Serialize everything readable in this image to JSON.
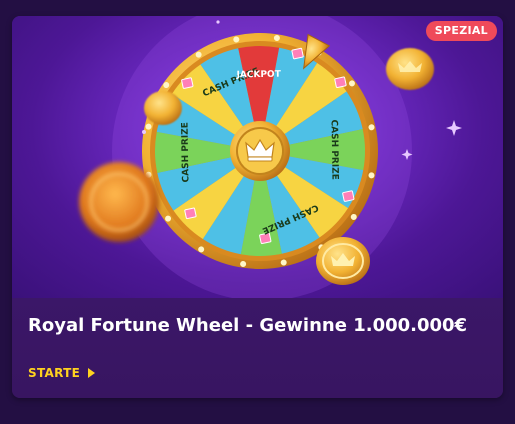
{
  "promo": {
    "badge": "SPEZIAL",
    "title": "Royal Fortune Wheel - Gewinne 1.000.000€",
    "cta_label": "STARTE",
    "wheel": {
      "pointer_label": "JACKPOT",
      "segment_labels": [
        "CASH PRIZE",
        "CASH PRIZE",
        "CASH PRIZE",
        "CASH PRIZE"
      ]
    }
  },
  "colors": {
    "background": "#230f43",
    "badge": "#ef4a5a",
    "cta": "#ffd21f",
    "title": "#ffffff",
    "hero_purple": "#6a28c0"
  },
  "icons": [
    "coin-icon",
    "crown-icon",
    "arrow-right-icon",
    "sparkle-icon"
  ]
}
